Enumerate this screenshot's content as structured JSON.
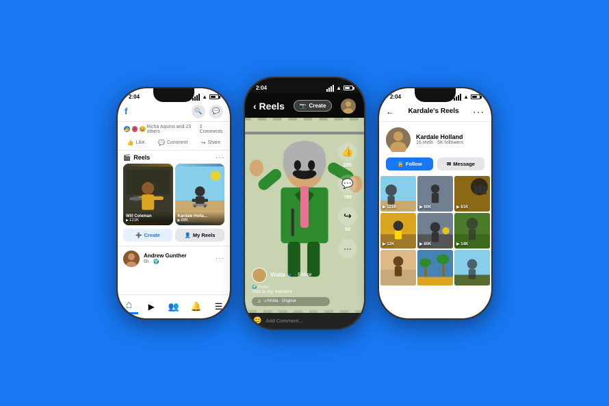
{
  "background_color": "#1877F2",
  "phones": {
    "left": {
      "time": "2:04",
      "post": {
        "reactions": "Richa Aquino and 23 others",
        "comments": "2 Comments",
        "like_label": "Like",
        "comment_label": "Comment",
        "share_label": "Share"
      },
      "reels_section": {
        "title": "Reels",
        "reel1": {
          "name": "Will Coleman",
          "views": "121K"
        },
        "reel2": {
          "name": "Kardale Holla...",
          "views": "88K"
        },
        "create_label": "Create",
        "my_reels_label": "My Reels"
      },
      "post_item": {
        "name": "Andrew Gunther",
        "time": "6h",
        "privacy": "·"
      },
      "nav": {
        "home": "⌂",
        "video": "▶",
        "people": "👥",
        "bell": "🔔",
        "menu": "☰"
      }
    },
    "center": {
      "time": "2:04",
      "back_label": "< Reels",
      "create_label": "Create",
      "user": {
        "name": "Vinita",
        "verified": "●",
        "follow_label": "· Follow",
        "privacy": "🌍 Public",
        "description": "This is my moment"
      },
      "audio": "♫/Vinita · Original",
      "comment_placeholder": "Add Comment...",
      "actions": {
        "likes": "22K",
        "comments": "780",
        "shares": "52"
      }
    },
    "right": {
      "time": "2:04",
      "page_title": "Kardale's Reels",
      "profile": {
        "name": "Kardale Holland",
        "stats": "16 reels · 6K followers",
        "follow_label": "Follow",
        "message_label": "Message"
      },
      "reels": [
        {
          "views": "▶ 121K",
          "bg": "pr-1"
        },
        {
          "views": "▶ 90K",
          "bg": "pr-2"
        },
        {
          "views": "▶ 81K",
          "bg": "pr-3"
        },
        {
          "views": "▶ 12K",
          "bg": "pr-4"
        },
        {
          "views": "▶ 80K",
          "bg": "pr-5"
        },
        {
          "views": "▶ 14K",
          "bg": "pr-6"
        },
        {
          "views": "",
          "bg": "pr-7"
        },
        {
          "views": "",
          "bg": "pr-8"
        },
        {
          "views": "",
          "bg": "pr-9"
        }
      ]
    }
  }
}
